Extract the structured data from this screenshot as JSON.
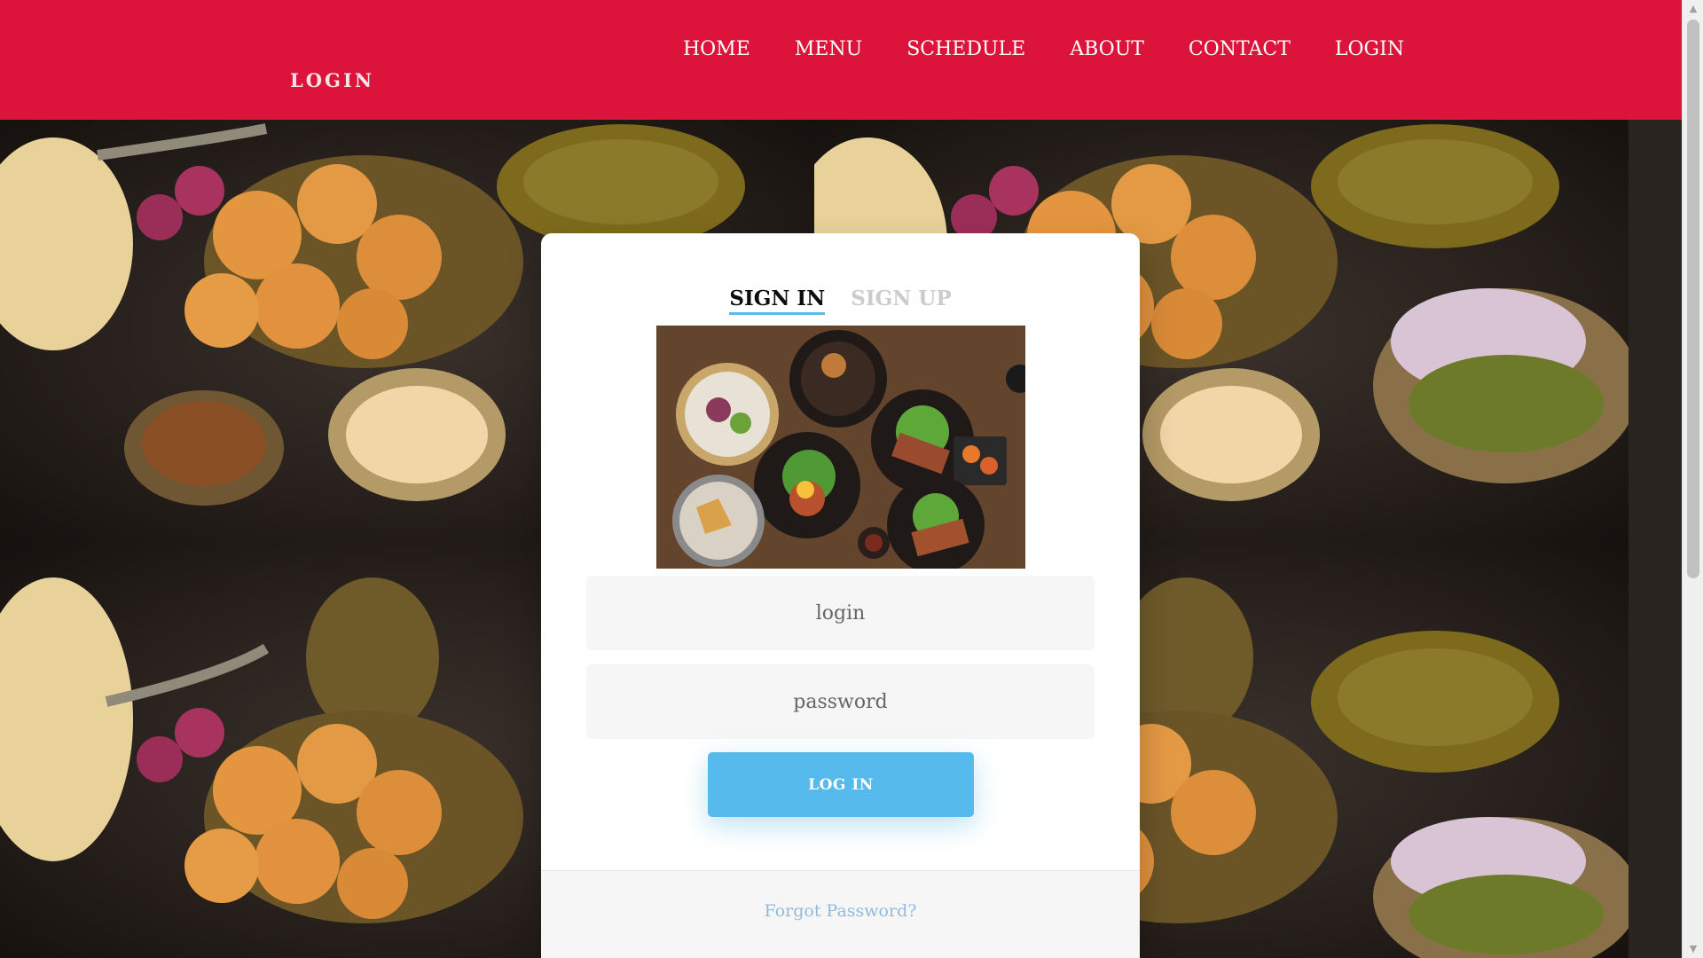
{
  "header": {
    "brand": "LOGIN",
    "nav": [
      {
        "label": "HOME"
      },
      {
        "label": "MENU"
      },
      {
        "label": "SCHEDULE"
      },
      {
        "label": "ABOUT"
      },
      {
        "label": "CONTACT"
      },
      {
        "label": "LOGIN"
      }
    ]
  },
  "card": {
    "tabs": {
      "sign_in": "SIGN IN",
      "sign_up": "SIGN UP"
    },
    "image": "food-photo",
    "login": {
      "placeholder": "login",
      "value": ""
    },
    "password": {
      "placeholder": "password",
      "value": ""
    },
    "submit_label": "LOG IN",
    "forgot_label": "Forgot Password?"
  },
  "colors": {
    "header_bg": "#dc143c",
    "button_bg": "#56baed",
    "tab_underline": "#5fbae9",
    "forgot_link": "#92badd"
  }
}
